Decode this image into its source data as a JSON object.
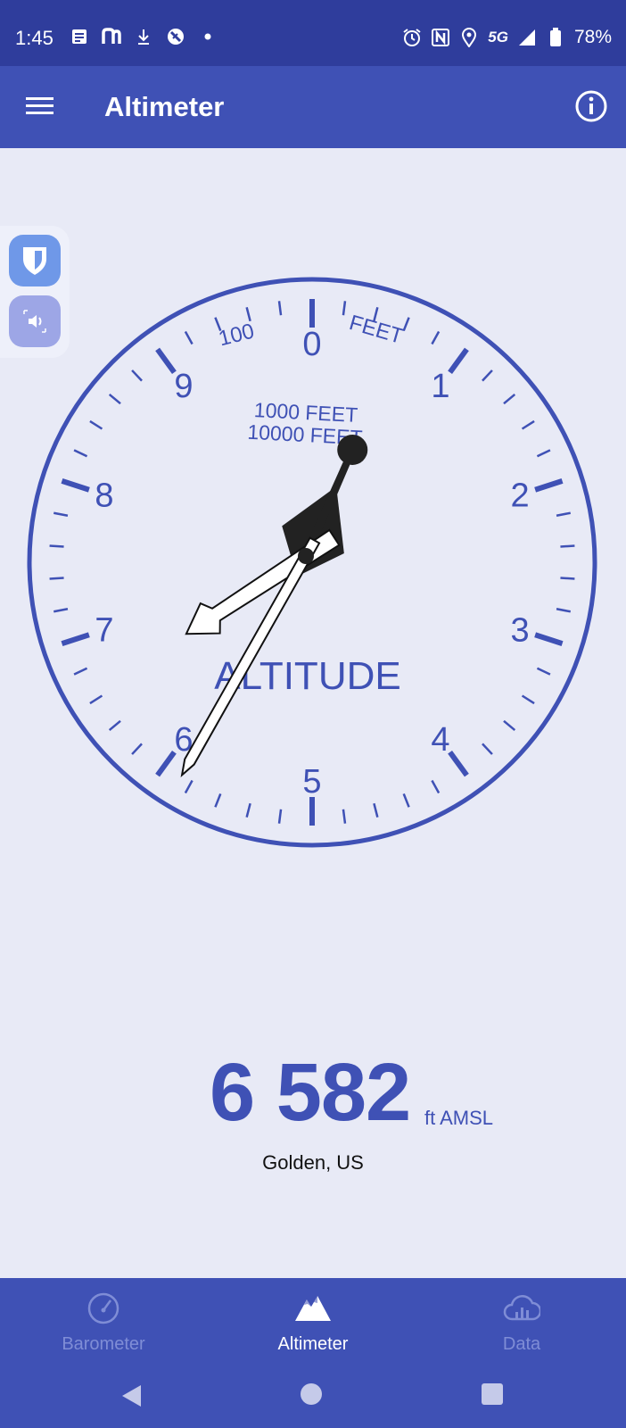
{
  "status_bar": {
    "time": "1:45",
    "network": "5G",
    "battery": "78%",
    "left_icons": [
      "document-icon",
      "n-app-icon",
      "download-icon",
      "sync-off-icon",
      "dot-icon"
    ],
    "right_icons": [
      "alarm-icon",
      "nfc-icon",
      "location-icon",
      "signal-icon",
      "battery-icon"
    ]
  },
  "app_bar": {
    "title": "Altimeter",
    "menu_icon": "hamburger-icon",
    "info_icon": "info-icon"
  },
  "floating_buttons": {
    "items": [
      "shield-icon",
      "speaker-icon"
    ]
  },
  "gauge": {
    "numbers": [
      "0",
      "1",
      "2",
      "3",
      "4",
      "5",
      "6",
      "7",
      "8",
      "9"
    ],
    "label_100": "100",
    "label_feet": "FEET",
    "label_1000": "1000 FEET",
    "label_10000": "10000 FEET",
    "label_altitude": "ALTITUDE",
    "altitude_ft": 6582,
    "color_primary": "#3f51b5"
  },
  "readout": {
    "value": "6 582",
    "unit": "ft AMSL",
    "location": "Golden, US"
  },
  "bottom_nav": {
    "items": [
      {
        "label": "Barometer",
        "icon": "gauge-icon",
        "active": false
      },
      {
        "label": "Altimeter",
        "icon": "mountain-icon",
        "active": true
      },
      {
        "label": "Data",
        "icon": "cloud-chart-icon",
        "active": false
      }
    ]
  },
  "system_nav": {
    "icons": [
      "back-icon",
      "home-icon",
      "recents-icon"
    ]
  }
}
